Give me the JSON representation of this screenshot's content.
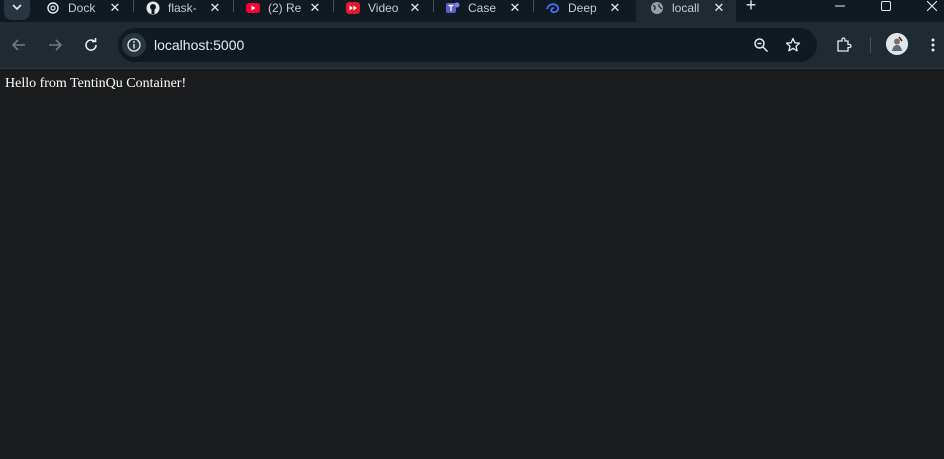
{
  "tabs": [
    {
      "title": "Dock",
      "icon": "openai-icon",
      "close": "✕"
    },
    {
      "title": "flask-",
      "icon": "github-icon",
      "close": "✕"
    },
    {
      "title": "(2) Re",
      "icon": "youtube-icon",
      "close": "✕"
    },
    {
      "title": "Video",
      "icon": "video-icon",
      "close": "✕"
    },
    {
      "title": "Case",
      "icon": "teams-icon",
      "close": "✕"
    },
    {
      "title": "Deep",
      "icon": "deepseek-icon",
      "close": "✕"
    },
    {
      "title": "locall",
      "icon": "globe-icon",
      "close": "✕",
      "active": true
    }
  ],
  "tab_strip": {
    "new_tab_label": "+"
  },
  "window_controls": {
    "minimize": "—",
    "maximize": "▢",
    "close": "✕"
  },
  "toolbar": {
    "url": "localhost:5000"
  },
  "page": {
    "text": "Hello from TentinQu Container!"
  },
  "colors": {
    "tab_strip_bg": "#0f1a22",
    "toolbar_bg": "#1f2a33",
    "omnibox_bg": "#0f1a22",
    "page_bg": "#1b1c1e",
    "text": "#ffffff"
  }
}
